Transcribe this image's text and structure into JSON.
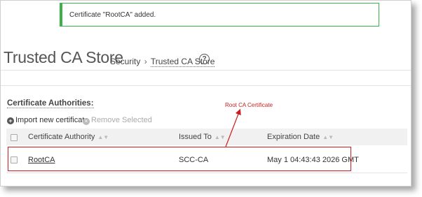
{
  "notification": {
    "text": "Certificate \"RootCA\" added."
  },
  "header": {
    "title": "Trusted CA Store",
    "breadcrumb": {
      "parent": "Security",
      "separator": "›",
      "current": "Trusted CA Store"
    },
    "help_icon": "question-circle-icon"
  },
  "section": {
    "title": "Certificate Authorities:"
  },
  "actions": {
    "import_label": "Import new certificate",
    "import_icon": "plus-circle-icon",
    "remove_label": "Remove Selected",
    "remove_icon": "x-circle-icon"
  },
  "table": {
    "columns": [
      "Certificate Authority",
      "Issued To",
      "Expiration Date"
    ],
    "rows": [
      {
        "authority": "RootCA",
        "issued_to": "SCC-CA",
        "expiration": "May 1 04:43:43 2026 GMT"
      }
    ]
  },
  "annotation": {
    "text": "Root CA Certificate",
    "color": "#c62020"
  },
  "colors": {
    "success_border": "#3cb14a",
    "highlight": "#d01c1c"
  }
}
